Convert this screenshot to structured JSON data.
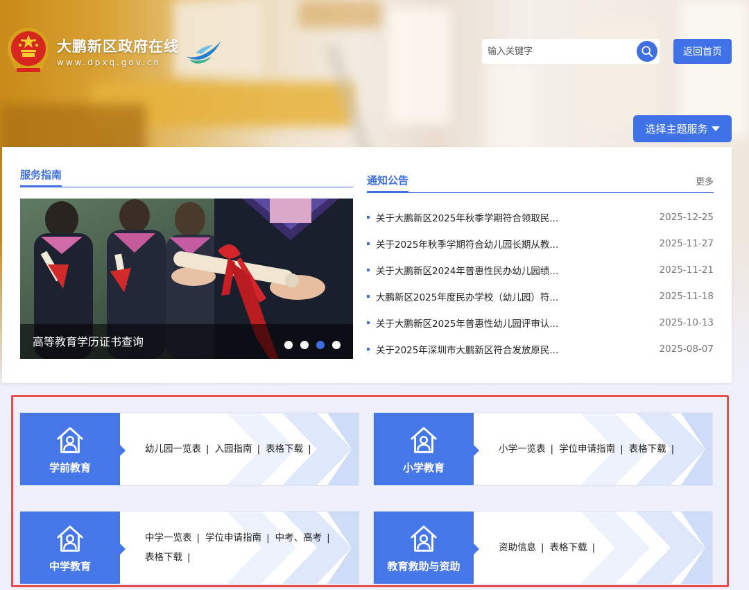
{
  "header": {
    "site_name": "大鹏新区政府在线",
    "site_url": "www.dpxq.gov.cn",
    "search_placeholder": "输入关键字",
    "home_button": "返回首页",
    "theme_button": "选择主题服务"
  },
  "service_guide": {
    "title": "服务指南",
    "carousel_caption": "高等教育学历证书查询",
    "active_slide": 3,
    "slide_count": 4
  },
  "notices": {
    "title": "通知公告",
    "more": "更多",
    "items": [
      {
        "title": "关于大鹏新区2025年秋季学期符合领取民...",
        "date": "2025-12-25"
      },
      {
        "title": "关于2025年秋季学期符合幼儿园长期从教...",
        "date": "2025-11-27"
      },
      {
        "title": "关于大鹏新区2024年普惠性民办幼儿园绩...",
        "date": "2025-11-21"
      },
      {
        "title": "大鹏新区2025年度民办学校（幼儿园）符...",
        "date": "2025-11-18"
      },
      {
        "title": "关于大鹏新区2025年普惠性幼儿园评审认...",
        "date": "2025-10-13"
      },
      {
        "title": "关于2025年深圳市大鹏新区符合发放原民...",
        "date": "2025-08-07"
      }
    ]
  },
  "cards": [
    {
      "label": "学前教育",
      "links": [
        "幼儿园一览表",
        "入园指南",
        "表格下载"
      ]
    },
    {
      "label": "小学教育",
      "links": [
        "小学一览表",
        "学位申请指南",
        "表格下载"
      ]
    },
    {
      "label": "中学教育",
      "links": [
        "中学一览表",
        "学位申请指南",
        "中考、高考",
        "表格下载"
      ]
    },
    {
      "label": "教育救助与资助",
      "links": [
        "资助信息",
        "表格下载"
      ]
    }
  ],
  "colors": {
    "primary": "#3f72e6",
    "card_side": "#4677e8",
    "highlight_border": "#e84c4c"
  }
}
